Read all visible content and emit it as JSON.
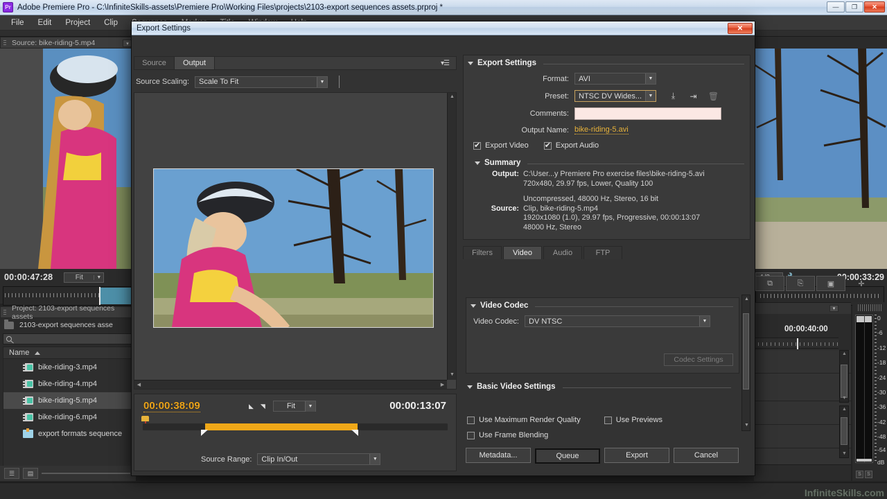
{
  "window": {
    "app_title": "Adobe Premiere Pro - C:\\InfiniteSkills-assets\\Premiere Pro\\Working Files\\projects\\2103-export sequences assets.prproj *",
    "logo": "Pr",
    "minimize": "—",
    "restore": "❐",
    "close": "✕"
  },
  "menubar": {
    "items": [
      "File",
      "Edit",
      "Project",
      "Clip",
      "Sequence",
      "Marker",
      "Title",
      "Window",
      "Help"
    ]
  },
  "source_monitor": {
    "tab_label": "Source: bike-riding-5.mp4",
    "timecode": "00:00:47:28",
    "zoom_level": "Fit",
    "buttons": [
      "marker",
      "in",
      "out"
    ]
  },
  "program_monitor": {
    "zoom_level": "1/2",
    "timecode": "00:00:33:29",
    "buttons": [
      "export-frame",
      "lift",
      "camera",
      "add"
    ]
  },
  "project_panel": {
    "tab_label": "Project: 2103-export sequences assets",
    "folder_name": "2103-export sequences asse",
    "search_placeholder": "",
    "column_header": "Name",
    "items": [
      {
        "name": "bike-riding-3.mp4",
        "type": "clip",
        "selected": false
      },
      {
        "name": "bike-riding-4.mp4",
        "type": "clip",
        "selected": false
      },
      {
        "name": "bike-riding-5.mp4",
        "type": "clip",
        "selected": true
      },
      {
        "name": "bike-riding-6.mp4",
        "type": "clip",
        "selected": false
      },
      {
        "name": "export formats sequence",
        "type": "sequence",
        "selected": false
      }
    ]
  },
  "timeline_panel": {
    "timecode": "00:00:40:00"
  },
  "audio_meters": {
    "scale": [
      "0",
      "-6",
      "-12",
      "-18",
      "-24",
      "-30",
      "-36",
      "-42",
      "-48",
      "-54",
      "dB"
    ],
    "solo_buttons": [
      "S",
      "S"
    ]
  },
  "dialog": {
    "title": "Export Settings",
    "close": "✕",
    "preview": {
      "tabs": [
        {
          "label": "Source",
          "active": false
        },
        {
          "label": "Output",
          "active": true
        }
      ],
      "scaling_label": "Source Scaling:",
      "scaling_value": "Scale To Fit",
      "current_timecode": "00:00:38:09",
      "duration_timecode": "00:00:13:07",
      "zoom_level": "Fit",
      "source_range_label": "Source Range:",
      "source_range_value": "Clip In/Out"
    },
    "export_settings": {
      "group_title": "Export Settings",
      "format_label": "Format:",
      "format_value": "AVI",
      "preset_label": "Preset:",
      "preset_value": "NTSC DV Wides...",
      "comments_label": "Comments:",
      "comments_value": "",
      "output_name_label": "Output Name:",
      "output_name_value": "bike-riding-5.avi",
      "export_video_label": "Export Video",
      "export_video_checked": true,
      "export_audio_label": "Export Audio",
      "export_audio_checked": true,
      "preset_icons": [
        "save-preset-icon",
        "import-preset-icon",
        "delete-preset-icon"
      ]
    },
    "summary": {
      "title": "Summary",
      "output_key": "Output:",
      "output_line1": "C:\\User...y Premiere Pro exercise files\\bike-riding-5.avi",
      "output_line2": "720x480, 29.97 fps, Lower, Quality 100",
      "output_line3": "Uncompressed, 48000 Hz, Stereo, 16 bit",
      "source_key": "Source:",
      "source_line1": "Clip, bike-riding-5.mp4",
      "source_line2": "1920x1080 (1.0), 29.97 fps, Progressive, 00:00:13:07",
      "source_line3": "48000 Hz, Stereo"
    },
    "settings_tabs": [
      {
        "label": "Filters",
        "active": false
      },
      {
        "label": "Video",
        "active": true
      },
      {
        "label": "Audio",
        "active": false
      },
      {
        "label": "FTP",
        "active": false
      }
    ],
    "video_codec": {
      "group_title": "Video Codec",
      "label": "Video Codec:",
      "value": "DV NTSC",
      "codec_settings_button": "Codec Settings"
    },
    "basic_video_settings": {
      "title": "Basic Video Settings"
    },
    "render_options": [
      {
        "label": "Use Maximum Render Quality",
        "checked": false
      },
      {
        "label": "Use Previews",
        "checked": false
      },
      {
        "label": "Use Frame Blending",
        "checked": false
      }
    ],
    "footer_buttons": [
      {
        "label": "Metadata...",
        "primary": false
      },
      {
        "label": "Queue",
        "primary": true
      },
      {
        "label": "Export",
        "primary": false
      },
      {
        "label": "Cancel",
        "primary": false
      }
    ]
  },
  "watermark": "InfiniteSkills.com",
  "colors": {
    "accent": "#e8b33a",
    "dialog_bg": "#333333",
    "panel_bg": "#2b2b2b",
    "close_red": "#d43e1e"
  }
}
